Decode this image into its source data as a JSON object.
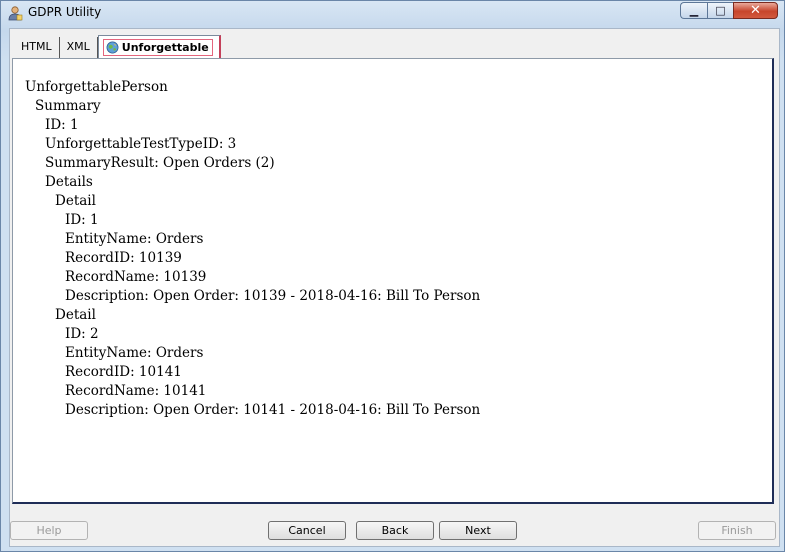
{
  "window": {
    "title": "GDPR Utility",
    "minimize_glyph": "▁",
    "maximize_glyph": "□",
    "close_glyph": "✕"
  },
  "tabs": [
    {
      "label": "HTML",
      "active": false
    },
    {
      "label": "XML",
      "active": false
    },
    {
      "label": "Unforgettable",
      "active": true,
      "icon": "globe-icon"
    }
  ],
  "tree": [
    {
      "text": "UnforgettablePerson",
      "depth": 0
    },
    {
      "text": "Summary",
      "depth": 1
    },
    {
      "text": "ID: 1",
      "depth": 2
    },
    {
      "text": "UnforgettableTestTypeID: 3",
      "depth": 2
    },
    {
      "text": "SummaryResult: Open Orders (2)",
      "depth": 2
    },
    {
      "text": "Details",
      "depth": 2
    },
    {
      "text": "Detail",
      "depth": 3
    },
    {
      "text": "ID: 1",
      "depth": 4
    },
    {
      "text": "EntityName: Orders",
      "depth": 4
    },
    {
      "text": "RecordID: 10139",
      "depth": 4
    },
    {
      "text": "RecordName: 10139",
      "depth": 4
    },
    {
      "text": "Description: Open Order: 10139 - 2018-04-16: Bill To Person",
      "depth": 4
    },
    {
      "text": "Detail",
      "depth": 3
    },
    {
      "text": "ID: 2",
      "depth": 4
    },
    {
      "text": "EntityName: Orders",
      "depth": 4
    },
    {
      "text": "RecordID: 10141",
      "depth": 4
    },
    {
      "text": "RecordName: 10141",
      "depth": 4
    },
    {
      "text": "Description: Open Order: 10141 - 2018-04-16: Bill To Person",
      "depth": 4
    }
  ],
  "buttons": {
    "help": "Help",
    "cancel": "Cancel",
    "back": "Back",
    "next": "Next",
    "finish": "Finish"
  }
}
